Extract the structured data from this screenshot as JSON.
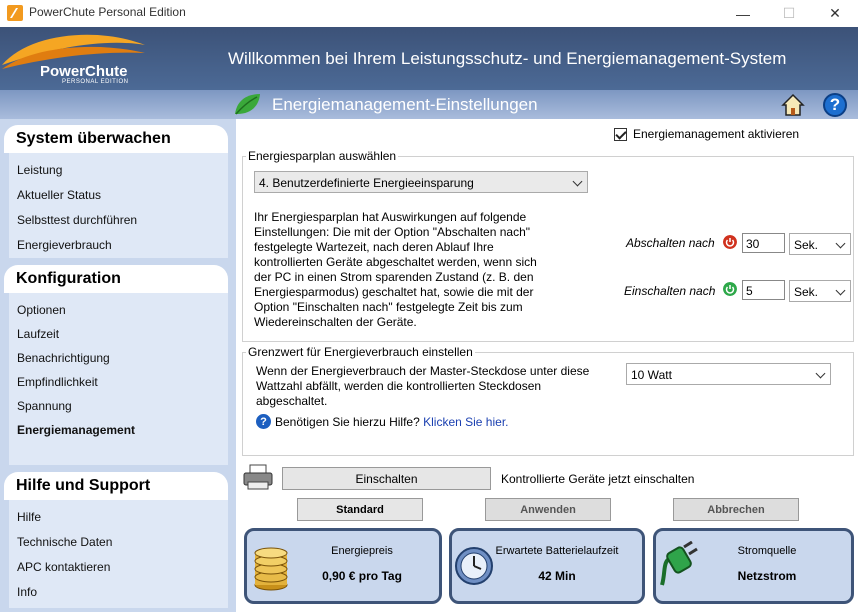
{
  "window": {
    "title": "PowerChute Personal Edition",
    "minimize": "—",
    "maximize": "☐",
    "close": "✕"
  },
  "header": {
    "logo_text": "PowerChute",
    "logo_sub": "PERSONAL EDITION",
    "title": "Willkommen bei Ihrem Leistungsschutz- und Energiemanagement-System"
  },
  "subheader": {
    "title": "Energiemanagement-Einstellungen",
    "help": "?"
  },
  "sidebar": {
    "sections": [
      {
        "title": "System überwachen",
        "items": [
          "Leistung",
          "Aktueller Status",
          "Selbsttest durchführen",
          "Energieverbrauch"
        ]
      },
      {
        "title": "Konfiguration",
        "items": [
          "Optionen",
          "Laufzeit",
          "Benachrichtigung",
          "Empfindlichkeit",
          "Spannung",
          "Energiemanagement"
        ]
      },
      {
        "title": "Hilfe und Support",
        "items": [
          "Hilfe",
          "Technische Daten",
          "APC kontaktieren",
          "Info"
        ]
      }
    ]
  },
  "main": {
    "enable_checkbox": {
      "label": "Energiemanagement aktivieren",
      "checked": true
    },
    "plan_group": {
      "label": "Energiesparplan auswählen",
      "selected_plan": "4. Benutzerdefinierte Energieeinsparung",
      "description": "Ihr Energiesparplan hat Auswirkungen auf folgende Einstellungen: Die mit der Option \"Abschalten nach\" festgelegte Wartezeit, nach deren Ablauf Ihre kontrollierten Geräte abgeschaltet werden, wenn sich der PC in einen Strom sparenden Zustand (z. B. den Energiesparmodus) geschaltet hat, sowie die mit der Option \"Einschalten nach\" festgelegte Zeit bis zum Wiedereinschalten der Geräte.",
      "off_label": "Abschalten nach",
      "off_value": "30",
      "off_unit": "Sek.",
      "on_label": "Einschalten nach",
      "on_value": "5",
      "on_unit": "Sek."
    },
    "threshold_group": {
      "label": "Grenzwert für Energieverbrauch einstellen",
      "description": "Wenn der Energieverbrauch der Master-Steckdose unter diese Wattzahl abfällt, werden die kontrollierten Steckdosen abgeschaltet.",
      "selected_watt": "10 Watt",
      "help_text": "Benötigen Sie hierzu Hilfe?",
      "help_link": "Klicken Sie hier."
    },
    "einschalten_button": "Einschalten",
    "einschalten_desc": "Kontrollierte Geräte jetzt einschalten",
    "standard_button": "Standard",
    "apply_button": "Anwenden",
    "cancel_button": "Abbrechen"
  },
  "status_cards": [
    {
      "title": "Energiepreis",
      "value": "0,90 € pro Tag",
      "icon": "coins-icon"
    },
    {
      "title": "Erwartete Batterielaufzeit",
      "value": "42 Min",
      "icon": "clock-icon"
    },
    {
      "title": "Stromquelle",
      "value": "Netzstrom",
      "icon": "plug-icon"
    }
  ],
  "colors": {
    "header_dark": "#3c5278",
    "subheader": "#a9bcdc",
    "sidebar_bg": "#c9d7ed",
    "card_border": "#3e5478",
    "link": "#1a3fb0"
  }
}
